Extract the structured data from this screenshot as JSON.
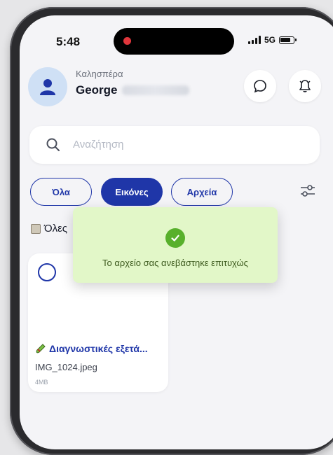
{
  "status_bar": {
    "time": "5:48",
    "network": "5G"
  },
  "header": {
    "greeting": "Καλησπέρα",
    "user_first_name": "George"
  },
  "search": {
    "placeholder": "Αναζήτηση"
  },
  "filters": {
    "all_label": "Όλα",
    "images_label": "Εικόνες",
    "files_label": "Αρχεία",
    "selected": "Εικόνες"
  },
  "section": {
    "label": "Όλες"
  },
  "file_card": {
    "title": "Διαγνωστικές εξετά...",
    "file_name": "IMG_1024.jpeg",
    "file_size": "4MB"
  },
  "toast": {
    "message": "Το αρχείο σας ανεβάστηκε επιτυχώς"
  },
  "colors": {
    "accent": "#1f36a8",
    "toast_background": "#e2f7c8",
    "success": "#58b02c",
    "recording_dot": "#e0363c"
  },
  "icons": {
    "chat": "chat-bubble-icon",
    "notifications": "bell-icon",
    "search": "search-icon",
    "filter": "sliders-icon",
    "success": "check-circle-icon",
    "avatar": "user-icon"
  }
}
